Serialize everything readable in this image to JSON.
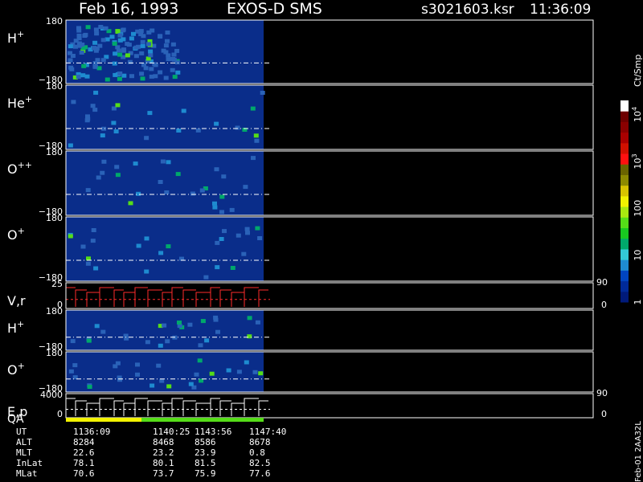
{
  "header": {
    "date": "Feb 16, 1993",
    "instrument": "EXOS-D SMS",
    "file": "s3021603.ksr",
    "time": "11:36:09"
  },
  "chart_data": {
    "type": "heatmap",
    "panels": [
      {
        "id": "h1",
        "species": "H",
        "charge": "+",
        "ymax_label": "180",
        "ymin_label": "−180"
      },
      {
        "id": "he1",
        "species": "He",
        "charge": "+",
        "ymax_label": "180",
        "ymin_label": "−180"
      },
      {
        "id": "opp",
        "species": "O",
        "charge": "++",
        "ymax_label": "180",
        "ymin_label": "−180"
      },
      {
        "id": "o1",
        "species": "O",
        "charge": "+",
        "ymax_label": "180",
        "ymin_label": "−180"
      },
      {
        "id": "vr",
        "species": "V,r",
        "charge": "",
        "ymax_label": "25",
        "ymin_label": "0",
        "right_top": "90",
        "right_bottom": "0"
      },
      {
        "id": "h2",
        "species": "H",
        "charge": "+",
        "ymax_label": "180",
        "ymin_label": "−180"
      },
      {
        "id": "o2",
        "species": "O",
        "charge": "+",
        "ymax_label": "180",
        "ymin_label": "−180"
      },
      {
        "id": "ep",
        "species": "E,p",
        "charge": "",
        "ymax_label": "4000",
        "ymin_label": "0",
        "right_top": "90",
        "right_bottom": "0"
      }
    ],
    "qa_label": "QA",
    "colorbar": {
      "unit": "Ct/Smp",
      "ticks": [
        {
          "label": "1",
          "value": 1
        },
        {
          "label": "10",
          "value": 10
        },
        {
          "label": "100",
          "value": 100
        }
      ],
      "power_ticks": [
        {
          "base": "10",
          "exp": "3",
          "value": 1000
        },
        {
          "base": "10",
          "exp": "4",
          "value": 10000
        }
      ],
      "colors": [
        "#001a7a",
        "#002a9a",
        "#0044c0",
        "#1e8bd0",
        "#33c9d6",
        "#00a86b",
        "#18c820",
        "#55dd18",
        "#a8e810",
        "#f2f200",
        "#d8c400",
        "#8d8a00",
        "#6a6400",
        "#ff1010",
        "#d01000",
        "#aa0000",
        "#8a0000",
        "#6e0000",
        "#ffffff"
      ]
    },
    "footer": {
      "rows": [
        {
          "name": "UT",
          "values": [
            "1136:09",
            "1140:25",
            "1143:56",
            "1147:40"
          ]
        },
        {
          "name": "ALT",
          "values": [
            "8284",
            "8468",
            "8586",
            "8678"
          ]
        },
        {
          "name": "MLT",
          "values": [
            "22.6",
            "23.2",
            "23.9",
            "0.8"
          ]
        },
        {
          "name": "InLat",
          "values": [
            "78.1",
            "80.1",
            "81.5",
            "82.5"
          ]
        },
        {
          "name": "MLat",
          "values": [
            "70.6",
            "73.7",
            "75.9",
            "77.6"
          ]
        }
      ],
      "vertical_note": "Feb-01 2AA32L"
    }
  }
}
